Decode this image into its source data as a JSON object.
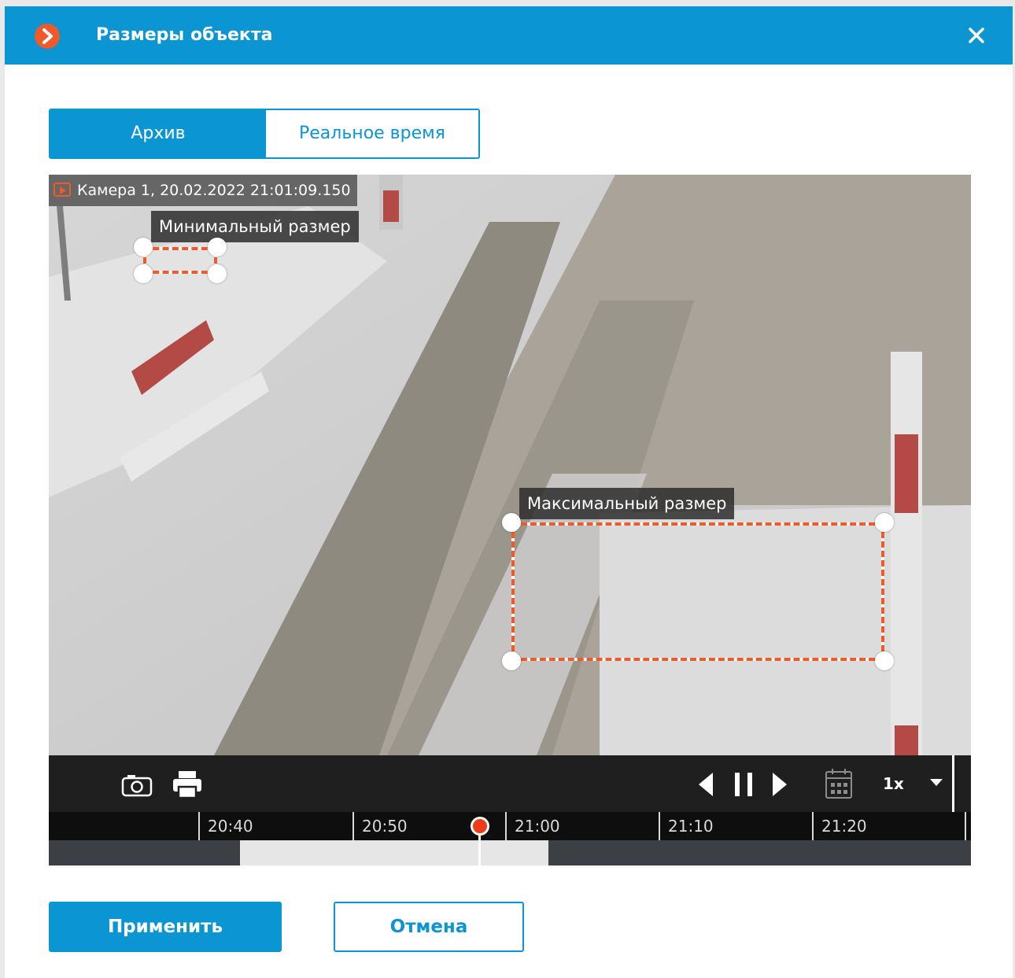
{
  "dialog": {
    "title": "Размеры объекта",
    "logo_icon": "chevron-right-icon",
    "close_icon": "close-icon",
    "accent_color": "#0b95d3",
    "brand_color": "#ef5a2a"
  },
  "tabs": [
    {
      "label": "Архив",
      "active": true
    },
    {
      "label": "Реальное время",
      "active": false
    }
  ],
  "viewer": {
    "camera_label": "Камера 1, 20.02.2022 21:01:09.150",
    "min_size_label": "Минимальный размер",
    "max_size_label": "Максимальный размер"
  },
  "toolbar": {
    "snapshot_icon": "camera-icon",
    "print_icon": "print-icon",
    "prev_icon": "prev-frame-icon",
    "pause_icon": "pause-icon",
    "next_icon": "next-frame-icon",
    "calendar_icon": "calendar-icon",
    "speed": "1x",
    "speed_dropdown_icon": "chevron-down-icon"
  },
  "timeline": {
    "ticks": [
      "20:40",
      "20:50",
      "21:00",
      "21:10",
      "21:20"
    ]
  },
  "buttons": {
    "apply": "Применить",
    "cancel": "Отмена"
  }
}
